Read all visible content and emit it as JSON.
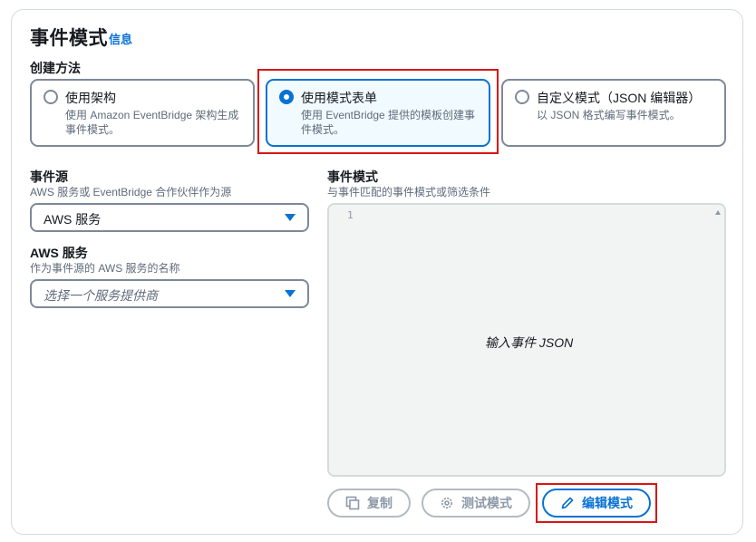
{
  "header": {
    "title": "事件模式",
    "info_link": "信息"
  },
  "creation_method": {
    "label": "创建方法",
    "options": [
      {
        "label": "使用架构",
        "description_line1": "使用 Amazon EventBridge 架构生成",
        "description_line2": "事件模式。",
        "selected": false
      },
      {
        "label": "使用模式表单",
        "description_line1": "使用 EventBridge 提供的模板创建事",
        "description_line2": "件模式。",
        "selected": true
      },
      {
        "label": "自定义模式（JSON 编辑器）",
        "description_line1": "以 JSON 格式编写事件模式。",
        "description_line2": "",
        "selected": false
      }
    ]
  },
  "event_source": {
    "label": "事件源",
    "description": "AWS 服务或 EventBridge 合作伙伴作为源",
    "value": "AWS 服务"
  },
  "aws_service": {
    "label": "AWS 服务",
    "description": "作为事件源的 AWS 服务的名称",
    "placeholder": "选择一个服务提供商"
  },
  "event_pattern": {
    "label": "事件模式",
    "description": "与事件匹配的事件模式或筛选条件",
    "line_number": "1",
    "placeholder": "输入事件 JSON"
  },
  "actions": {
    "copy_label": "复制",
    "test_label": "测试模式",
    "edit_label": "编辑模式"
  },
  "colors": {
    "accent": "#0972d3",
    "highlight": "#d91515",
    "border": "#7d8998"
  }
}
